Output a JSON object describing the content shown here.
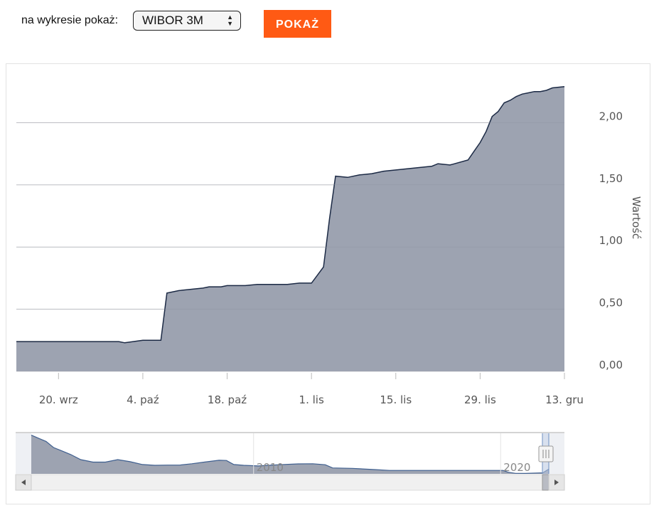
{
  "controls": {
    "label": "na wykresie pokaż:",
    "select_value": "WIBOR 3M",
    "button_label": "POKAŻ"
  },
  "colors": {
    "accent": "#ff5a14",
    "area_fill": "#9da3b1",
    "line": "#1c2a45"
  },
  "chart_data": {
    "type": "area",
    "ylabel": "Wartość",
    "ylim": [
      0,
      2.3
    ],
    "y_ticks": [
      {
        "v": 0.0,
        "label": "0,00"
      },
      {
        "v": 0.5,
        "label": "0,50"
      },
      {
        "v": 1.0,
        "label": "1,00"
      },
      {
        "v": 1.5,
        "label": "1,50"
      },
      {
        "v": 2.0,
        "label": "2,00"
      }
    ],
    "x_ticks": [
      {
        "d": "2021-09-20",
        "label": "20. wrz"
      },
      {
        "d": "2021-10-04",
        "label": "4. paź"
      },
      {
        "d": "2021-10-18",
        "label": "18. paź"
      },
      {
        "d": "2021-11-01",
        "label": "1. lis"
      },
      {
        "d": "2021-11-15",
        "label": "15. lis"
      },
      {
        "d": "2021-11-29",
        "label": "29. lis"
      },
      {
        "d": "2021-12-13",
        "label": "13. gru"
      }
    ],
    "x_range": [
      "2021-09-13",
      "2021-12-13"
    ],
    "series": [
      {
        "points": [
          [
            "2021-09-13",
            0.24
          ],
          [
            "2021-09-20",
            0.24
          ],
          [
            "2021-09-27",
            0.24
          ],
          [
            "2021-09-30",
            0.24
          ],
          [
            "2021-10-01",
            0.23
          ],
          [
            "2021-10-04",
            0.25
          ],
          [
            "2021-10-07",
            0.25
          ],
          [
            "2021-10-08",
            0.63
          ],
          [
            "2021-10-10",
            0.65
          ],
          [
            "2021-10-14",
            0.67
          ],
          [
            "2021-10-15",
            0.68
          ],
          [
            "2021-10-17",
            0.68
          ],
          [
            "2021-10-18",
            0.69
          ],
          [
            "2021-10-20",
            0.69
          ],
          [
            "2021-10-21",
            0.69
          ],
          [
            "2021-10-23",
            0.7
          ],
          [
            "2021-10-28",
            0.7
          ],
          [
            "2021-10-30",
            0.71
          ],
          [
            "2021-11-01",
            0.71
          ],
          [
            "2021-11-03",
            0.84
          ],
          [
            "2021-11-04",
            1.23
          ],
          [
            "2021-11-05",
            1.57
          ],
          [
            "2021-11-07",
            1.56
          ],
          [
            "2021-11-09",
            1.58
          ],
          [
            "2021-11-11",
            1.59
          ],
          [
            "2021-11-13",
            1.61
          ],
          [
            "2021-11-15",
            1.62
          ],
          [
            "2021-11-17",
            1.63
          ],
          [
            "2021-11-19",
            1.64
          ],
          [
            "2021-11-21",
            1.65
          ],
          [
            "2021-11-22",
            1.67
          ],
          [
            "2021-11-24",
            1.66
          ],
          [
            "2021-11-27",
            1.7
          ],
          [
            "2021-11-28",
            1.77
          ],
          [
            "2021-11-29",
            1.84
          ],
          [
            "2021-11-30",
            1.93
          ],
          [
            "2021-12-01",
            2.05
          ],
          [
            "2021-12-02",
            2.09
          ],
          [
            "2021-12-03",
            2.16
          ],
          [
            "2021-12-04",
            2.18
          ],
          [
            "2021-12-05",
            2.21
          ],
          [
            "2021-12-06",
            2.23
          ],
          [
            "2021-12-07",
            2.24
          ],
          [
            "2021-12-08",
            2.25
          ],
          [
            "2021-12-09",
            2.25
          ],
          [
            "2021-12-10",
            2.26
          ],
          [
            "2021-12-11",
            2.28
          ],
          [
            "2021-12-13",
            2.29
          ]
        ]
      }
    ],
    "navigator": {
      "labels": [
        {
          "year": 2010,
          "label": "2010"
        },
        {
          "year": 2020,
          "label": "2020"
        }
      ],
      "x_range_years": [
        2001.0,
        2021.95
      ],
      "ylim": [
        0,
        20
      ],
      "points": [
        [
          2001.0,
          19.1
        ],
        [
          2001.3,
          17.5
        ],
        [
          2001.6,
          16.0
        ],
        [
          2001.9,
          13.0
        ],
        [
          2002.2,
          11.5
        ],
        [
          2002.6,
          9.5
        ],
        [
          2003.0,
          7.0
        ],
        [
          2003.5,
          5.8
        ],
        [
          2004.0,
          5.8
        ],
        [
          2004.5,
          7.0
        ],
        [
          2005.0,
          6.0
        ],
        [
          2005.5,
          4.6
        ],
        [
          2006.0,
          4.2
        ],
        [
          2006.5,
          4.3
        ],
        [
          2007.0,
          4.3
        ],
        [
          2007.5,
          5.0
        ],
        [
          2008.0,
          5.8
        ],
        [
          2008.6,
          6.7
        ],
        [
          2008.9,
          6.6
        ],
        [
          2009.2,
          4.6
        ],
        [
          2009.6,
          4.2
        ],
        [
          2010.2,
          3.9
        ],
        [
          2011.0,
          4.5
        ],
        [
          2011.8,
          4.9
        ],
        [
          2012.4,
          5.0
        ],
        [
          2012.9,
          4.5
        ],
        [
          2013.2,
          2.9
        ],
        [
          2014.0,
          2.7
        ],
        [
          2014.9,
          2.1
        ],
        [
          2015.5,
          1.7
        ],
        [
          2016.5,
          1.7
        ],
        [
          2017.5,
          1.7
        ],
        [
          2018.5,
          1.7
        ],
        [
          2019.5,
          1.7
        ],
        [
          2020.1,
          1.7
        ],
        [
          2020.3,
          0.8
        ],
        [
          2020.6,
          0.25
        ],
        [
          2021.0,
          0.21
        ],
        [
          2021.7,
          0.5
        ],
        [
          2021.95,
          2.3
        ]
      ]
    }
  }
}
